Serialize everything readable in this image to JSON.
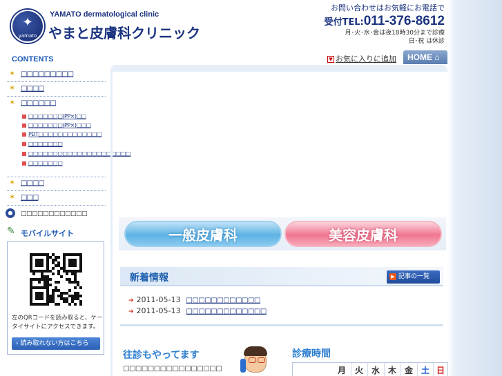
{
  "header": {
    "logo_mark_text": "yamato",
    "logo_en": "YAMATO dermatological clinic",
    "logo_ja": "やまと皮膚科クリニック",
    "contact_line": "お問い合わせはお気軽にお電話で",
    "tel_prefix": "受付TEL:",
    "tel_number": "011-376-8612",
    "hours_line1": "月･火･水･金は夜18時30分まで診療",
    "hours_line2": "日･祝 は休診",
    "favorites_label": "お気に入りに追加",
    "home_label": "HOME"
  },
  "sidebar": {
    "contents_title": "CONTENTS",
    "nav_items": [
      {
        "label": "□□□□□□□□□"
      },
      {
        "label": "□□□□"
      },
      {
        "label": "□□□□□□"
      }
    ],
    "sub_items": [
      {
        "label": "□□□□□□□(PP×)□□"
      },
      {
        "label": "□□□□□□□(PP×)□□□"
      },
      {
        "label": "PDT□□□□□□□□□□□□□"
      },
      {
        "label": "□□□□□□□"
      },
      {
        "label": "□□□□□□□□□□□□□□□□□□□□□"
      },
      {
        "label": "□□□□□□□"
      }
    ],
    "nav_items_bottom": [
      {
        "label": "□□□□"
      },
      {
        "label": "□□□"
      }
    ],
    "info_label": "□□□□□□□□□□□□",
    "mobile_title": "モバイルサイト",
    "mobile_text": "左のQRコードを読み取ると、ケータイサイトにアクセスできます。",
    "mobile_button": "› 読み取れない方はこちら"
  },
  "main": {
    "btn_general": "一般皮膚科",
    "btn_beauty": "美容皮膚科",
    "news_title": "新着情報",
    "news_all_label": "記事の一覧",
    "news": [
      {
        "date": "2011-05-13",
        "title": "□□□□□□□□□□□□"
      },
      {
        "date": "2011-05-13",
        "title": "□□□□□□□□□□□□□"
      }
    ],
    "visit_title": "往診もやってます",
    "visit_desc": "□□□□□□□□□□□□□□□□",
    "hours_title": "診療時間",
    "days": [
      "月",
      "火",
      "水",
      "木",
      "金",
      "土",
      "日"
    ]
  },
  "colors": {
    "brand_navy": "#1c3480",
    "link_blue": "#1c3480",
    "accent_blue": "#3080d0",
    "saturday": "#2060d0",
    "sunday": "#d02020"
  }
}
